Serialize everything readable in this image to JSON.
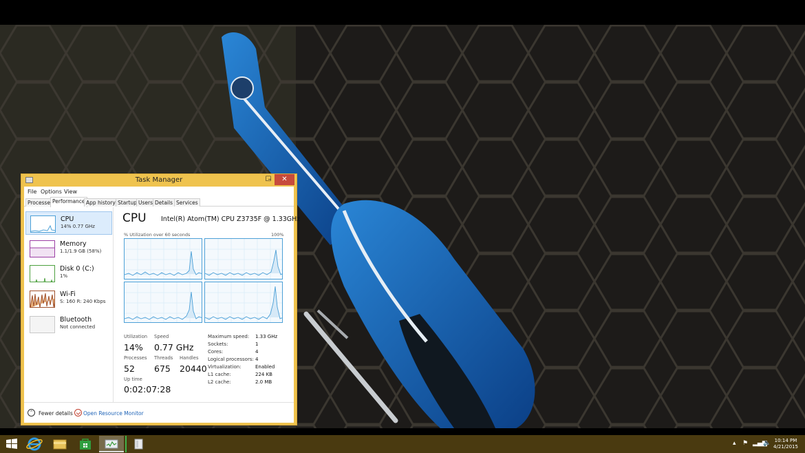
{
  "window": {
    "title": "Task Manager",
    "minimize": "–",
    "maximize": "☐",
    "close": "✕"
  },
  "menu": [
    "File",
    "Options",
    "View"
  ],
  "tabs": [
    "Processes",
    "Performance",
    "App history",
    "Startup",
    "Users",
    "Details",
    "Services"
  ],
  "active_tab": "Performance",
  "resources": [
    {
      "name": "CPU",
      "detail": "14% 0.77 GHz",
      "color": "#4ca0d7"
    },
    {
      "name": "Memory",
      "detail": "1.1/1.9 GB (58%)",
      "color": "#9b3fa4"
    },
    {
      "name": "Disk 0 (C:)",
      "detail": "1%",
      "color": "#4da03f"
    },
    {
      "name": "Wi-Fi",
      "detail": "S: 160  R: 240 Kbps",
      "color": "#a0522d"
    },
    {
      "name": "Bluetooth",
      "detail": "Not connected",
      "color": "#aaaaaa"
    }
  ],
  "cpu": {
    "heading": "CPU",
    "model": "Intel(R) Atom(TM) CPU  Z3735F @ 1.33GHz",
    "utilization_caption": "% Utilization over 60 seconds",
    "max_caption": "100%",
    "stats": {
      "utilization_label": "Utilization",
      "utilization": "14%",
      "speed_label": "Speed",
      "speed": "0.77 GHz",
      "processes_label": "Processes",
      "processes": "52",
      "threads_label": "Threads",
      "threads": "675",
      "handles_label": "Handles",
      "handles": "20440",
      "uptime_label": "Up time",
      "uptime": "0:02:07:28"
    },
    "specs": [
      {
        "label": "Maximum speed:",
        "value": "1.33 GHz"
      },
      {
        "label": "Sockets:",
        "value": "1"
      },
      {
        "label": "Cores:",
        "value": "4"
      },
      {
        "label": "Logical processors:",
        "value": "4"
      },
      {
        "label": "Virtualization:",
        "value": "Enabled"
      },
      {
        "label": "L1 cache:",
        "value": "224 KB"
      },
      {
        "label": "L2 cache:",
        "value": "2.0 MB"
      }
    ]
  },
  "footer": {
    "fewer_details": "Fewer details",
    "open_resource_monitor": "Open Resource Monitor"
  },
  "taskbar": {
    "apps": [
      "start-icon",
      "internet-explorer-icon",
      "file-explorer-icon",
      "store-icon",
      "task-manager-icon",
      "document-icon"
    ],
    "time": "10:14 PM",
    "date": "4/21/2015"
  },
  "colors": {
    "window_frame": "#efc34e",
    "close_button": "#c74b3c",
    "cpu_graph": "#4ca0d7",
    "taskbar": "#4a3a10",
    "link": "#1f64b8"
  }
}
